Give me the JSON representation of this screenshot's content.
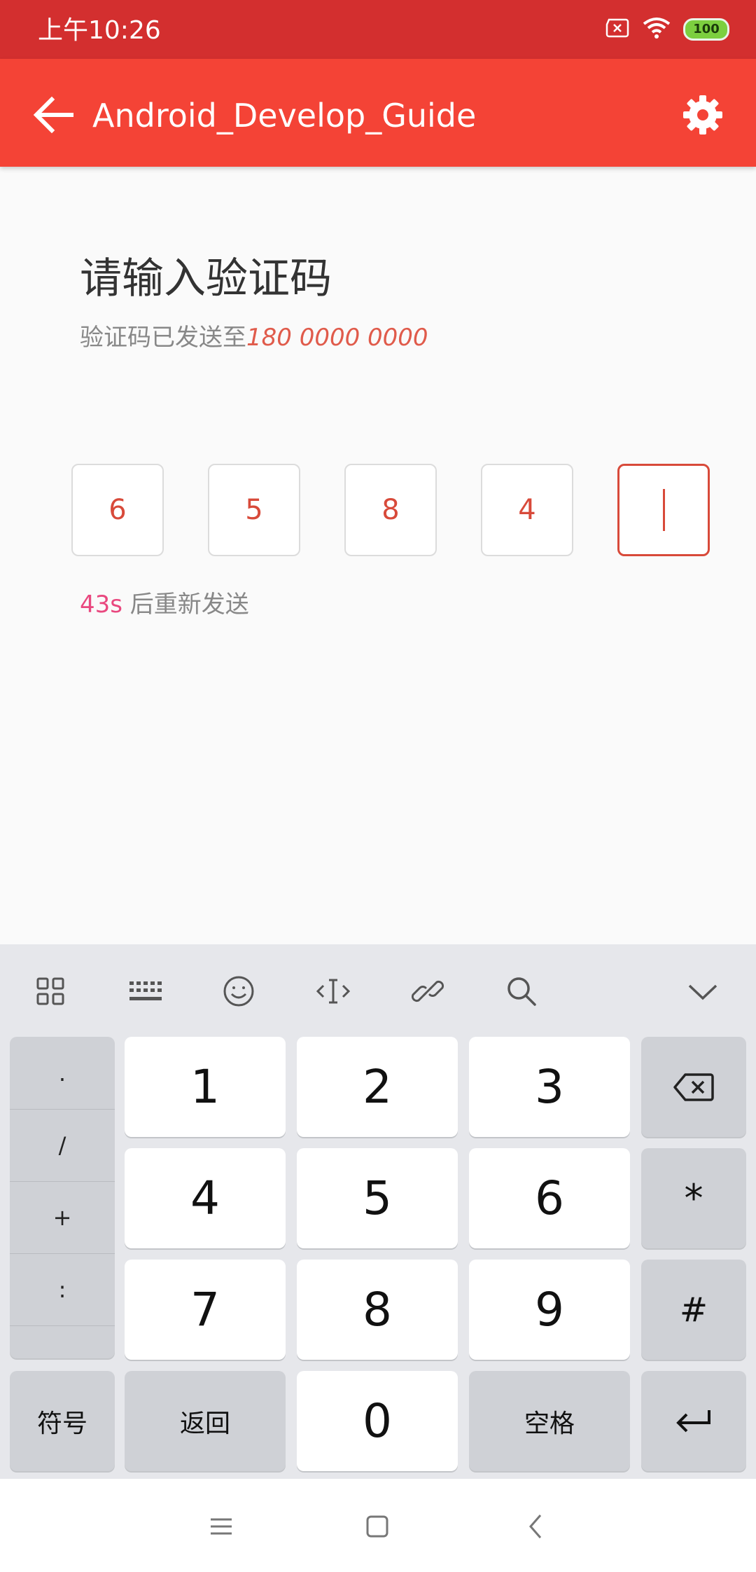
{
  "status_bar": {
    "time": "上午10:26",
    "battery": "100"
  },
  "toolbar": {
    "title": "Android_Develop_Guide"
  },
  "content": {
    "title": "请输入验证码",
    "subtitle_prefix": "验证码已发送至",
    "phone": "180 0000 0000",
    "code_digits": [
      "6",
      "5",
      "8",
      "4",
      ""
    ],
    "countdown": "43s",
    "resend_suffix": " 后重新发送"
  },
  "keyboard": {
    "toolbar_icons": [
      "grid-icon",
      "keyboard-icon",
      "emoji-icon",
      "cursor-move-icon",
      "link-icon",
      "search-icon",
      "chevron-down-icon"
    ],
    "symbols": [
      ".",
      "/",
      "+",
      ":"
    ],
    "digits": {
      "k1": "1",
      "k2": "2",
      "k3": "3",
      "k4": "4",
      "k5": "5",
      "k6": "6",
      "k7": "7",
      "k8": "8",
      "k9": "9",
      "k0": "0"
    },
    "star": "*",
    "hash": "#",
    "symbols_label": "符号",
    "back_label": "返回",
    "space_label": "空格"
  },
  "colors": {
    "status_bar": "#d32f2f",
    "toolbar": "#f44336",
    "accent": "#d84a3a",
    "countdown": "#e9487f"
  }
}
